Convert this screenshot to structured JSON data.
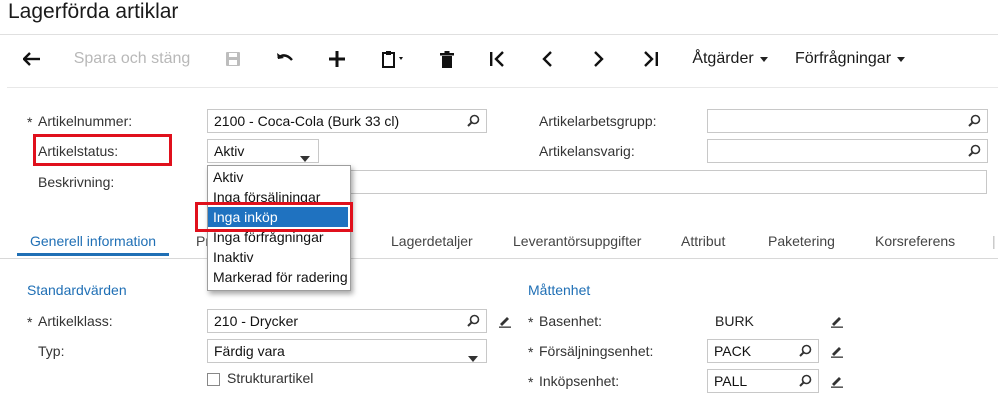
{
  "page": {
    "title": "Lagerförda artiklar"
  },
  "toolbar": {
    "save_close": "Spara och stäng",
    "actions": "Åtgärder",
    "inquiries": "Förfrågningar"
  },
  "form": {
    "item_number": {
      "label": "Artikelnummer:",
      "value": "2100 - Coca-Cola (Burk 33 cl)"
    },
    "item_status": {
      "label": "Artikelstatus:",
      "value": "Aktiv"
    },
    "description": {
      "label": "Beskrivning:",
      "value_fragment": ")"
    },
    "work_group": {
      "label": "Artikelarbetsgrupp:",
      "value": ""
    },
    "manager": {
      "label": "Artikelansvarig:",
      "value": ""
    }
  },
  "status_dropdown": {
    "options": [
      "Aktiv",
      "Inga försäljningar",
      "Inga inköp",
      "Inga förfrågningar",
      "Inaktiv",
      "Markerad för radering"
    ],
    "highlighted": "Inga inköp"
  },
  "tabs": [
    "Generell information",
    "Pr",
    "Lagerdetaljer",
    "Leverantörsuppgifter",
    "Attribut",
    "Paketering",
    "Korsreferens"
  ],
  "active_tab": "Generell information",
  "defaults": {
    "section_title": "Standardvärden",
    "item_class": {
      "label": "Artikelklass:",
      "value": "210 - Drycker"
    },
    "type": {
      "label": "Typ:",
      "value": "Färdig vara"
    },
    "structure_item": {
      "label": "Strukturartikel",
      "checked": false
    }
  },
  "uom": {
    "section_title": "Måttenhet",
    "base": {
      "label": "Basenhet:",
      "value": "BURK"
    },
    "sales": {
      "label": "Försäljningsenhet:",
      "value": "PACK"
    },
    "purchase": {
      "label": "Inköpsenhet:",
      "value": "PALL"
    }
  },
  "required_marker": "*",
  "colors": {
    "accent": "#1f6fb5",
    "highlight": "#e0101c",
    "selection": "#1f72c0"
  }
}
